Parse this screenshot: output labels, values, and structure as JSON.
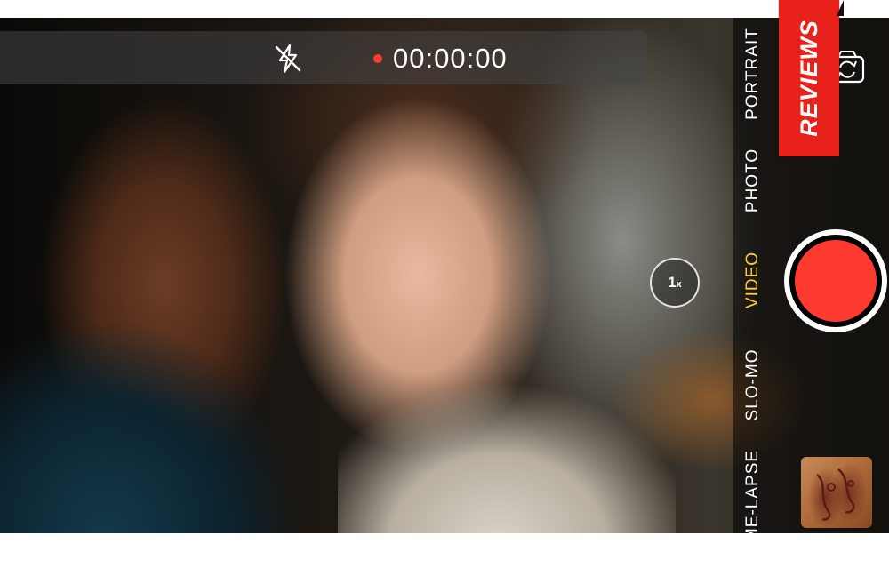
{
  "status_bar": {
    "recording_time": "00:00:00",
    "flash_state": "off"
  },
  "modes": {
    "portrait": "PORTRAIT",
    "photo": "PHOTO",
    "video": "VIDEO",
    "slomo": "SLO-MO",
    "timelapse": "ME-LAPSE",
    "active": "VIDEO"
  },
  "zoom": {
    "value": "1",
    "unit": "x"
  },
  "badge": {
    "label": "REVIEWS"
  },
  "icons": {
    "flash": "flash-off-icon",
    "flip": "flip-camera-icon",
    "record": "record-dot-icon"
  },
  "colors": {
    "record_red": "#ff3b30",
    "active_mode": "#ffcc33",
    "badge_red": "#e8211b"
  }
}
